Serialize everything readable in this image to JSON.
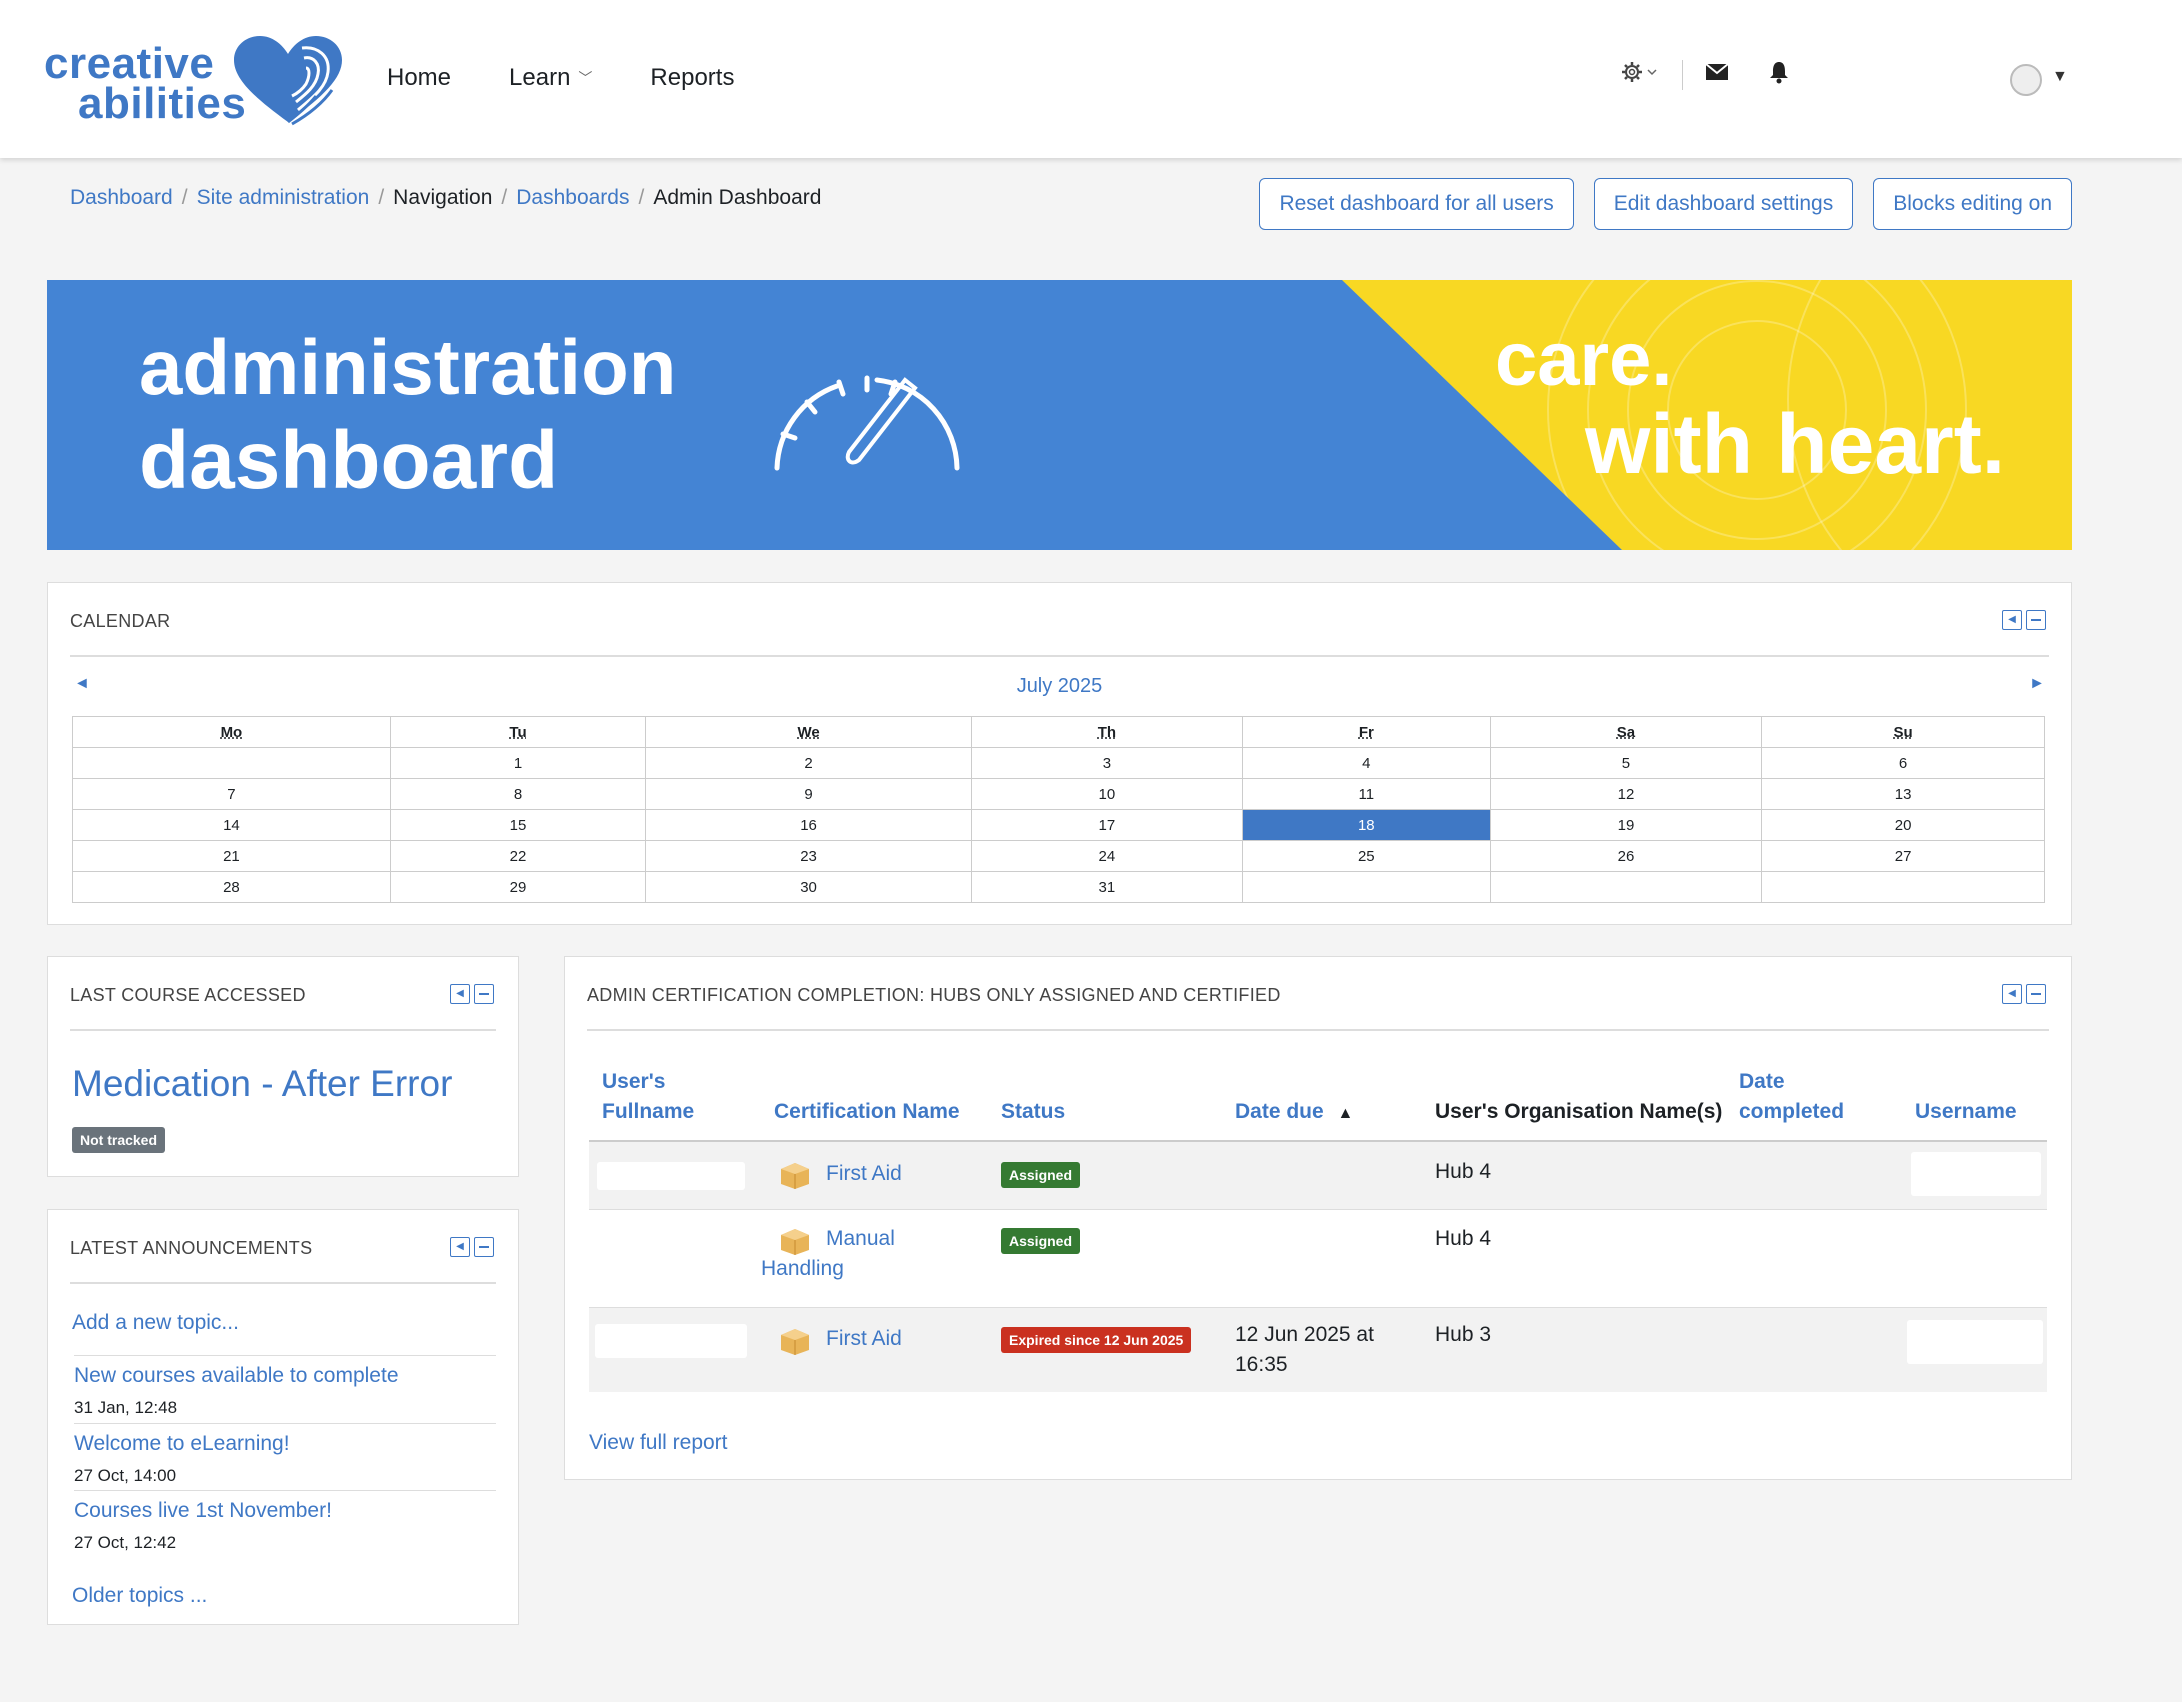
{
  "brand": {
    "logo_line1": "creative",
    "logo_line2": "abilities",
    "primary_color": "#3f78c5",
    "accent_color": "#f8d823"
  },
  "nav": {
    "home": "Home",
    "learn": "Learn",
    "reports": "Reports"
  },
  "breadcrumb": {
    "items": [
      "Dashboard",
      "Site administration",
      "Navigation",
      "Dashboards",
      "Admin Dashboard"
    ]
  },
  "header_buttons": {
    "reset": "Reset dashboard for all users",
    "edit": "Edit dashboard settings",
    "blocks": "Blocks editing on"
  },
  "banner": {
    "title_line1": "administration",
    "title_line2": "dashboard",
    "slogan_line1": "care.",
    "slogan_line2": "with heart."
  },
  "calendar": {
    "title": "CALENDAR",
    "month": "July 2025",
    "days": [
      "Mo",
      "Tu",
      "We",
      "Th",
      "Fr",
      "Sa",
      "Su"
    ],
    "weeks": [
      [
        "",
        "1",
        "2",
        "3",
        "4",
        "5",
        "6"
      ],
      [
        "7",
        "8",
        "9",
        "10",
        "11",
        "12",
        "13"
      ],
      [
        "14",
        "15",
        "16",
        "17",
        "18",
        "19",
        "20"
      ],
      [
        "21",
        "22",
        "23",
        "24",
        "25",
        "26",
        "27"
      ],
      [
        "28",
        "29",
        "30",
        "31",
        "",
        "",
        ""
      ]
    ],
    "today": "18"
  },
  "last_course": {
    "title": "LAST COURSE ACCESSED",
    "course": "Medication - After Error",
    "badge": "Not tracked"
  },
  "announcements": {
    "title": "LATEST ANNOUNCEMENTS",
    "add": "Add a new topic...",
    "items": [
      {
        "title": "New courses available to complete",
        "date": "31 Jan, 12:48"
      },
      {
        "title": "Welcome to eLearning!",
        "date": "27 Oct, 14:00"
      },
      {
        "title": "Courses live 1st November!",
        "date": "27 Oct, 12:42"
      }
    ],
    "older": "Older topics ..."
  },
  "certification": {
    "title": "ADMIN CERTIFICATION COMPLETION: HUBS ONLY ASSIGNED AND CERTIFIED",
    "columns": {
      "fullname_1": "User's",
      "fullname_2": "Fullname",
      "cert_name": "Certification Name",
      "status": "Status",
      "date_due": "Date due",
      "org": "User's Organisation Name(s)",
      "completed_1": "Date",
      "completed_2": "completed",
      "username": "Username"
    },
    "rows": [
      {
        "cert_line1": "First Aid",
        "cert_line2": "",
        "status": "Assigned",
        "date_due_1": "",
        "date_due_2": "",
        "org": "Hub 4"
      },
      {
        "cert_line1": "Manual",
        "cert_line2": "Handling",
        "status": "Assigned",
        "date_due_1": "",
        "date_due_2": "",
        "org": "Hub 4"
      },
      {
        "cert_line1": "First Aid",
        "cert_line2": "",
        "status": "Expired since 12 Jun 2025",
        "date_due_1": "12 Jun 2025 at",
        "date_due_2": "16:35",
        "org": "Hub 3"
      }
    ],
    "view_full": "View full report"
  }
}
